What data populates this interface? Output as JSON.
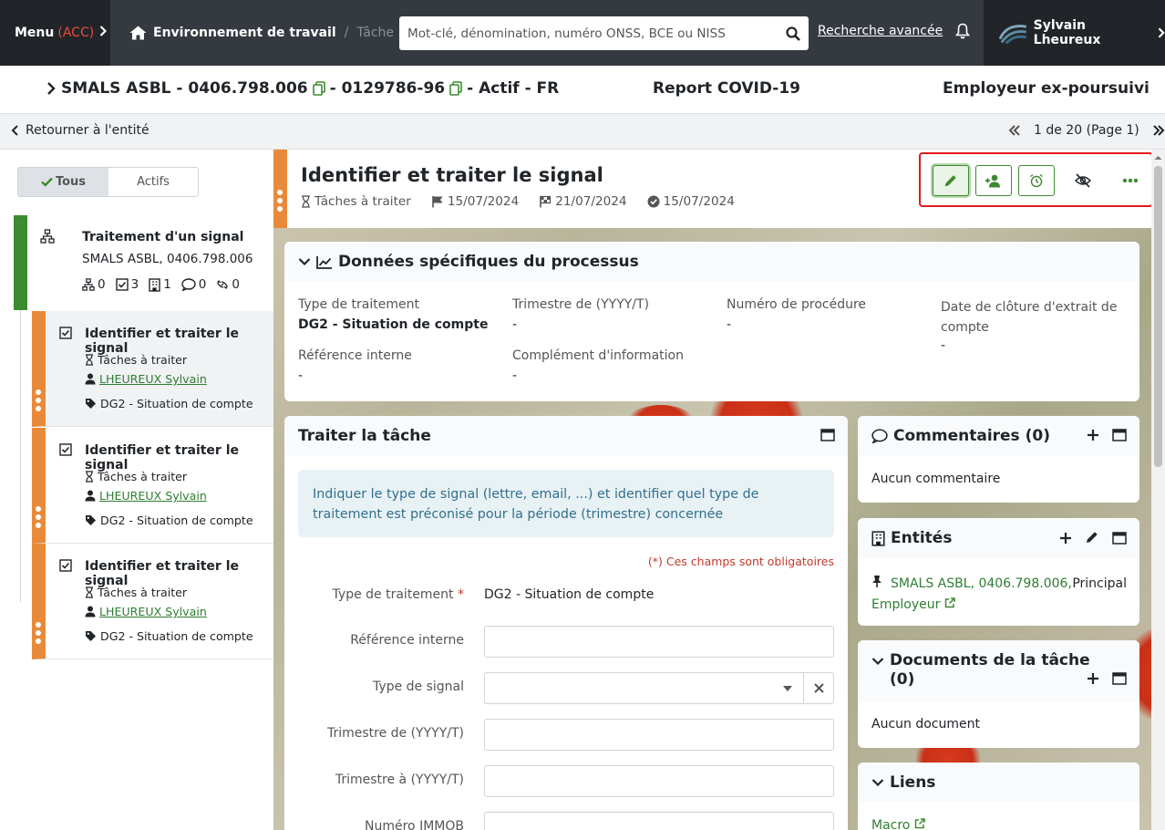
{
  "topbar": {
    "menu_label": "Menu",
    "menu_env": "(ACC)",
    "home_label": "Environnement de travail",
    "breadcrumb_sep": "/",
    "breadcrumb_current": "Tâche",
    "search_placeholder": "Mot-clé, dénomination, numéro ONSS, BCE ou NISS",
    "advanced_search": "Recherche avancée",
    "user_name": "Sylvain Lheureux"
  },
  "entity_bar": {
    "name": "SMALS ASBL - 0406.798.006",
    "sep1": "- 0129786-96",
    "status": "- Actif - FR",
    "center": "Report COVID-19",
    "right": "Employeur ex-poursuivi"
  },
  "nav": {
    "back": "Retourner à l'entité",
    "pagination": "1 de 20 (Page 1)"
  },
  "left_panel": {
    "filter_all": "Tous",
    "filter_active": "Actifs",
    "parent": {
      "title": "Traitement d'un signal",
      "subtitle": "SMALS ASBL, 0406.798.006",
      "counts": [
        "0",
        "3",
        "1",
        "0",
        "0"
      ]
    },
    "tasks": [
      {
        "title": "Identifier et traiter le signal",
        "status": "Tâches à traiter",
        "user": "LHEUREUX Sylvain",
        "tag": "DG2 - Situation de compte"
      },
      {
        "title": "Identifier et traiter le signal",
        "status": "Tâches à traiter",
        "user": "LHEUREUX Sylvain",
        "tag": "DG2 - Situation de compte"
      },
      {
        "title": "Identifier et traiter le signal",
        "status": "Tâches à traiter",
        "user": "LHEUREUX Sylvain",
        "tag": "DG2 - Situation de compte"
      }
    ]
  },
  "task": {
    "title": "Identifier et traiter le signal",
    "status": "Tâches à traiter",
    "date_start": "15/07/2024",
    "date_due": "21/07/2024",
    "date_done": "15/07/2024"
  },
  "process": {
    "title": "Données spécifiques du processus",
    "fields": [
      {
        "label": "Type de traitement",
        "value": "DG2 - Situation de compte"
      },
      {
        "label": "Trimestre de (YYYY/T)",
        "value": "-"
      },
      {
        "label": "Numéro de procédure",
        "value": "-"
      },
      {
        "label": "Date de clôture d'extrait de compte",
        "value": "-"
      },
      {
        "label": "Référence interne",
        "value": "-"
      },
      {
        "label": "Complément d'information",
        "value": "-"
      }
    ]
  },
  "treat": {
    "title": "Traiter la tâche",
    "info": "Indiquer le type de signal (lettre, email, ...) et identifier quel type de traitement est préconisé pour la période (trimestre) concernée",
    "required_note": "(*) Ces champs sont obligatoires",
    "type_label": "Type de traitement",
    "type_value": "DG2 - Situation de compte",
    "fields": [
      "Référence interne",
      "Type de signal",
      "Trimestre de (YYYY/T)",
      "Trimestre à (YYYY/T)",
      "Numéro IMMOB"
    ]
  },
  "comments": {
    "title": "Commentaires (0)",
    "empty": "Aucun commentaire"
  },
  "entities": {
    "title": "Entités",
    "link": "SMALS ASBL, 0406.798.006,",
    "role": "Principal",
    "type": "Employeur"
  },
  "documents": {
    "title": "Documents de la tâche (0)",
    "title_line1": "Documents de la tâche",
    "title_line2": "(0)",
    "empty": "Aucun document"
  },
  "links": {
    "title": "Liens",
    "item": "Macro"
  },
  "colors": {
    "topbar": "#343a40",
    "accent_green": "#3d8b2f",
    "accent_orange": "#e88a3a",
    "highlight": "#e0191c"
  }
}
